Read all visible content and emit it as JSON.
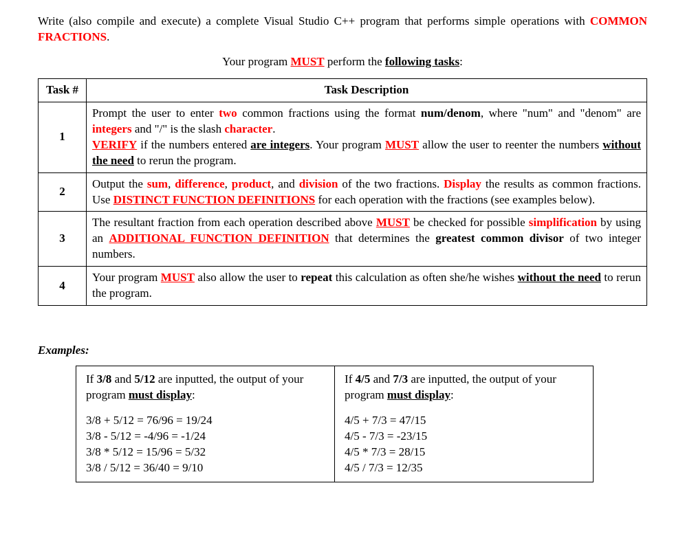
{
  "intro": {
    "pre": "Write (also compile and execute) a complete Visual Studio C++ program that performs simple operations with ",
    "emph": "COMMON FRACTIONS",
    "post": "."
  },
  "must_line": {
    "pre": "Your program ",
    "must": "MUST",
    "mid": " perform the ",
    "tasks": "following tasks",
    "post": ":"
  },
  "table": {
    "hdr_num": "Task #",
    "hdr_desc": "Task Description"
  },
  "task1": {
    "num": "1",
    "p1_a": "Prompt the user to enter ",
    "p1_two": "two",
    "p1_b": " common fractions using the format ",
    "p1_fmt": "num/denom",
    "p1_c": ", where \"num\" and \"denom\" are ",
    "p1_int": "integers",
    "p1_d": " and \"/\" is the slash ",
    "p1_char": "character",
    "p1_e": ".",
    "p2_verify": "VERIFY",
    "p2_a": " if the numbers entered ",
    "p2_areint": "are integers",
    "p2_b": ". Your program ",
    "p2_must": "MUST",
    "p2_c": " allow the user to reenter the numbers ",
    "p2_need": "without the need",
    "p2_d": " to rerun the program."
  },
  "task2": {
    "num": "2",
    "a": "Output the ",
    "sum": "sum",
    "c1": ", ",
    "diff": "difference",
    "c2": ", ",
    "prod": "product",
    "c3": ", and ",
    "div": "division",
    "b": " of the two fractions. ",
    "disp": "Display",
    "c": " the results as common fractions. Use ",
    "dfd": "DISTINCT FUNCTION DEFINITIONS",
    "d": " for each operation with the fractions (see examples below)."
  },
  "task3": {
    "num": "3",
    "a": "The resultant fraction from each operation described above ",
    "must": "MUST",
    "b": " be checked for possible ",
    "simp": "simplification",
    "c": " by using an ",
    "afd": "ADDITIONAL FUNCTION DEFINITION",
    "d": " that determines the ",
    "gcd": "greatest common divisor",
    "e": " of two integer numbers."
  },
  "task4": {
    "num": "4",
    "a": "Your program ",
    "must": "MUST",
    "b": " also allow the user to ",
    "rep": "repeat",
    "c": " this calculation as often she/he wishes ",
    "need": "without the need",
    "d": " to rerun the program."
  },
  "examples_heading": "Examples:",
  "ex1": {
    "intro_a": "If ",
    "f1": "3/8",
    "intro_b": " and ",
    "f2": "5/12",
    "intro_c": " are inputted, the output of your program ",
    "md": "must display",
    "intro_d": ":",
    "l1": "3/8 + 5/12 = 76/96 = 19/24",
    "l2": "3/8 - 5/12 = -4/96 = -1/24",
    "l3": "3/8 * 5/12 = 15/96 = 5/32",
    "l4": "3/8 / 5/12 = 36/40 = 9/10"
  },
  "ex2": {
    "intro_a": "If ",
    "f1": "4/5",
    "intro_b": " and ",
    "f2": "7/3",
    "intro_c": " are inputted, the output of your program ",
    "md": "must display",
    "intro_d": ":",
    "l1": "4/5 + 7/3 = 47/15",
    "l2": "4/5 - 7/3 = -23/15",
    "l3": "4/5 * 7/3 = 28/15",
    "l4": "4/5 / 7/3 = 12/35"
  }
}
